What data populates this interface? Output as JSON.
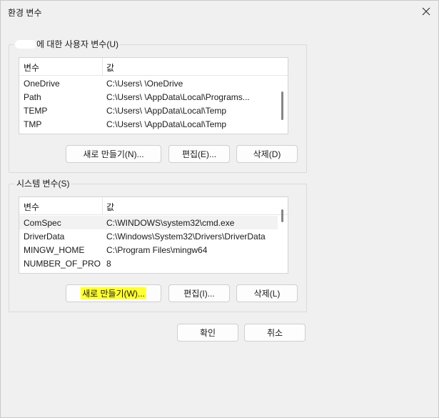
{
  "window": {
    "title": "환경 변수"
  },
  "user_vars": {
    "group_title": "에 대한 사용자 변수(U)",
    "col_name": "변수",
    "col_value": "값",
    "rows": [
      {
        "name": "OneDrive",
        "value": "C:\\Users\\        \\OneDrive"
      },
      {
        "name": "Path",
        "value": "C:\\Users\\      \\AppData\\Local\\Programs..."
      },
      {
        "name": "TEMP",
        "value": "C:\\Users\\      \\AppData\\Local\\Temp"
      },
      {
        "name": "TMP",
        "value": "C:\\Users\\      \\AppData\\Local\\Temp"
      }
    ],
    "buttons": {
      "new": "새로 만들기(N)...",
      "edit": "편집(E)...",
      "delete": "삭제(D)"
    }
  },
  "system_vars": {
    "group_title": "시스템 변수(S)",
    "col_name": "변수",
    "col_value": "값",
    "rows": [
      {
        "name": "ComSpec",
        "value": "C:\\WINDOWS\\system32\\cmd.exe"
      },
      {
        "name": "DriverData",
        "value": "C:\\Windows\\System32\\Drivers\\DriverData"
      },
      {
        "name": "MINGW_HOME",
        "value": "C:\\Program Files\\mingw64"
      },
      {
        "name": "NUMBER_OF_PRO...",
        "value": "8"
      }
    ],
    "buttons": {
      "new": "새로 만들기(W)...",
      "edit": "편집(I)...",
      "delete": "삭제(L)"
    }
  },
  "footer": {
    "ok": "확인",
    "cancel": "취소"
  },
  "colors": {
    "highlight": "#ffff33",
    "selected_row": "#f2f2f2"
  }
}
